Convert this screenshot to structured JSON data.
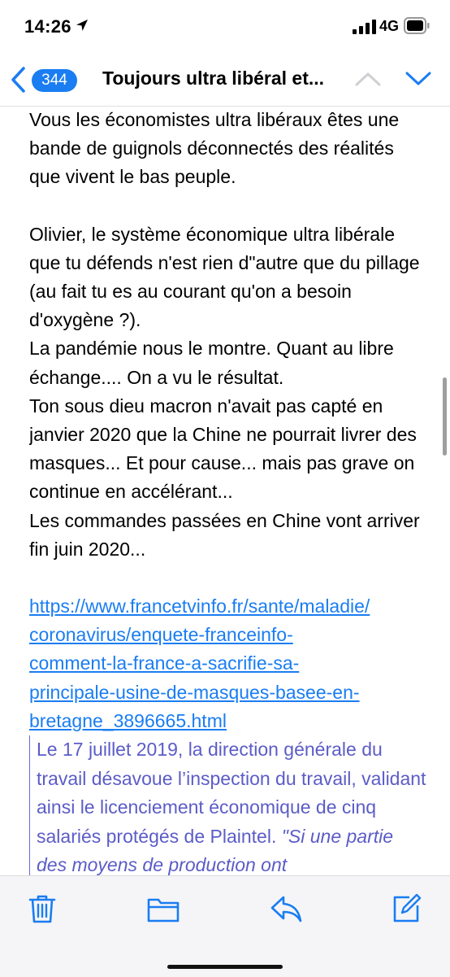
{
  "status": {
    "time": "14:26",
    "network": "4G"
  },
  "nav": {
    "badge": "344",
    "title": "Toujours ultra libéral et..."
  },
  "body": {
    "p1": "Vous les économistes ultra libéraux êtes une bande de guignols déconnectés des réalités que vivent le bas peuple.",
    "p2": [
      "Olivier, le système économique ultra libérale que tu défends n'est rien d\"autre que du pillage (au fait tu es au courant qu'on a besoin d'oxygène ?).",
      "La pandémie nous le montre. Quant au libre échange.... On a vu le résultat.",
      "Ton sous dieu macron n'avait pas capté en janvier 2020 que la Chine ne pourrait livrer des masques... Et pour cause... mais pas grave on continue en accélérant...",
      "Les commandes passées en Chine vont arriver fin juin 2020..."
    ],
    "link_lines": [
      "https://www.francetvinfo.fr/sante/maladie/",
      "coronavirus/enquete-franceinfo-",
      "comment-la-france-a-sacrifie-sa-",
      "principale-usine-de-masques-basee-en-",
      "bretagne_3896665.html"
    ],
    "quote": {
      "text": "Le 17 juillet 2019, la direction générale du travail désavoue l’inspection du travail, validant ainsi le licenciement économique de cinq salariés protégés de Plaintel. ",
      "italic": "\"Si une partie des moyens de production ont"
    }
  },
  "colors": {
    "accent": "#1a7df2",
    "quote": "#5c5cc8"
  },
  "toolbar": {
    "icons": [
      "trash-icon",
      "folder-icon",
      "reply-icon",
      "compose-icon"
    ]
  }
}
